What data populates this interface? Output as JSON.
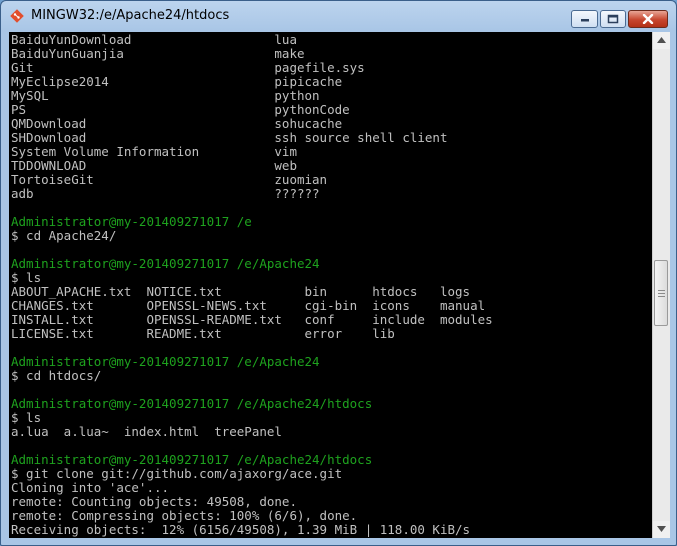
{
  "window": {
    "title": "MINGW32:/e/Apache24/htdocs",
    "icon": "git-diamond-icon",
    "accent": "#e24e2d"
  },
  "colors": {
    "background": "#000000",
    "text": "#c0c0c0",
    "prompt": "#1ea21e"
  },
  "terminal": {
    "lines": [
      {
        "text": "BaiduYunDownload                   lua",
        "type": "out"
      },
      {
        "text": "BaiduYunGuanjia                    make",
        "type": "out"
      },
      {
        "text": "Git                                pagefile.sys",
        "type": "out"
      },
      {
        "text": "MyEclipse2014                      pipicache",
        "type": "out"
      },
      {
        "text": "MySQL                              python",
        "type": "out"
      },
      {
        "text": "PS                                 pythonCode",
        "type": "out"
      },
      {
        "text": "QMDownload                         sohucache",
        "type": "out"
      },
      {
        "text": "SHDownload                         ssh source shell client",
        "type": "out"
      },
      {
        "text": "System Volume Information          vim",
        "type": "out"
      },
      {
        "text": "TDDOWNLOAD                         web",
        "type": "out"
      },
      {
        "text": "TortoiseGit                        zuomian",
        "type": "out"
      },
      {
        "text": "adb                                ??????",
        "type": "out"
      },
      {
        "text": "",
        "type": "out"
      },
      {
        "text": "Administrator@my-201409271017 /e",
        "type": "prompt"
      },
      {
        "text": "$ cd Apache24/",
        "type": "cmd"
      },
      {
        "text": "",
        "type": "out"
      },
      {
        "text": "Administrator@my-201409271017 /e/Apache24",
        "type": "prompt"
      },
      {
        "text": "$ ls",
        "type": "cmd"
      },
      {
        "text": "ABOUT_APACHE.txt  NOTICE.txt           bin      htdocs   logs",
        "type": "out"
      },
      {
        "text": "CHANGES.txt       OPENSSL-NEWS.txt     cgi-bin  icons    manual",
        "type": "out"
      },
      {
        "text": "INSTALL.txt       OPENSSL-README.txt   conf     include  modules",
        "type": "out"
      },
      {
        "text": "LICENSE.txt       README.txt           error    lib",
        "type": "out"
      },
      {
        "text": "",
        "type": "out"
      },
      {
        "text": "Administrator@my-201409271017 /e/Apache24",
        "type": "prompt"
      },
      {
        "text": "$ cd htdocs/",
        "type": "cmd"
      },
      {
        "text": "",
        "type": "out"
      },
      {
        "text": "Administrator@my-201409271017 /e/Apache24/htdocs",
        "type": "prompt"
      },
      {
        "text": "$ ls",
        "type": "cmd"
      },
      {
        "text": "a.lua  a.lua~  index.html  treePanel",
        "type": "out"
      },
      {
        "text": "",
        "type": "out"
      },
      {
        "text": "Administrator@my-201409271017 /e/Apache24/htdocs",
        "type": "prompt"
      },
      {
        "text": "$ git clone git://github.com/ajaxorg/ace.git",
        "type": "cmd"
      },
      {
        "text": "Cloning into 'ace'...",
        "type": "out"
      },
      {
        "text": "remote: Counting objects: 49508, done.",
        "type": "out"
      },
      {
        "text": "remote: Compressing objects: 100% (6/6), done.",
        "type": "out"
      },
      {
        "text": "Receiving objects:  12% (6156/49508), 1.39 MiB | 118.00 KiB/s",
        "type": "out"
      }
    ]
  }
}
